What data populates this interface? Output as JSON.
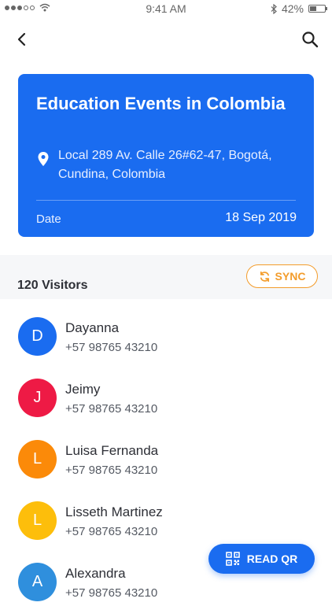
{
  "status_bar": {
    "time": "9:41 AM",
    "battery": "42%",
    "battery_level": 0.42,
    "icons": [
      "signal-dots-icon",
      "wifi-icon",
      "bluetooth-icon",
      "battery-icon"
    ]
  },
  "nav": {
    "back_icon": "chevron-left-icon",
    "search_icon": "search-icon"
  },
  "event": {
    "title": "Education Events in Colombia",
    "address": "Local 289 Av. Calle 26#62-47, Bogotá, Cundina, Colombia",
    "date_label": "Date",
    "date_value": "18 Sep 2019",
    "card_color": "#1a6cf0"
  },
  "visitors": {
    "count_label": "120 Visitors",
    "sync_label": "SYNC",
    "sync_color": "#f39c2b",
    "items": [
      {
        "initial": "D",
        "name": "Dayanna",
        "phone": "+57 98765 43210",
        "color": "#1a6cf0"
      },
      {
        "initial": "J",
        "name": "Jeimy",
        "phone": "+57 98765 43210",
        "color": "#ee1a45"
      },
      {
        "initial": "L",
        "name": "Luisa Fernanda",
        "phone": "+57 98765 43210",
        "color": "#fb8a09"
      },
      {
        "initial": "L",
        "name": "Lisseth Martinez",
        "phone": "+57 98765 43210",
        "color": "#fdbe0b"
      },
      {
        "initial": "A",
        "name": "Alexandra",
        "phone": "+57 98765 43210",
        "color": "#2f8fdd"
      }
    ]
  },
  "read_qr": {
    "label": "READ QR",
    "icon": "qr-code-icon"
  }
}
